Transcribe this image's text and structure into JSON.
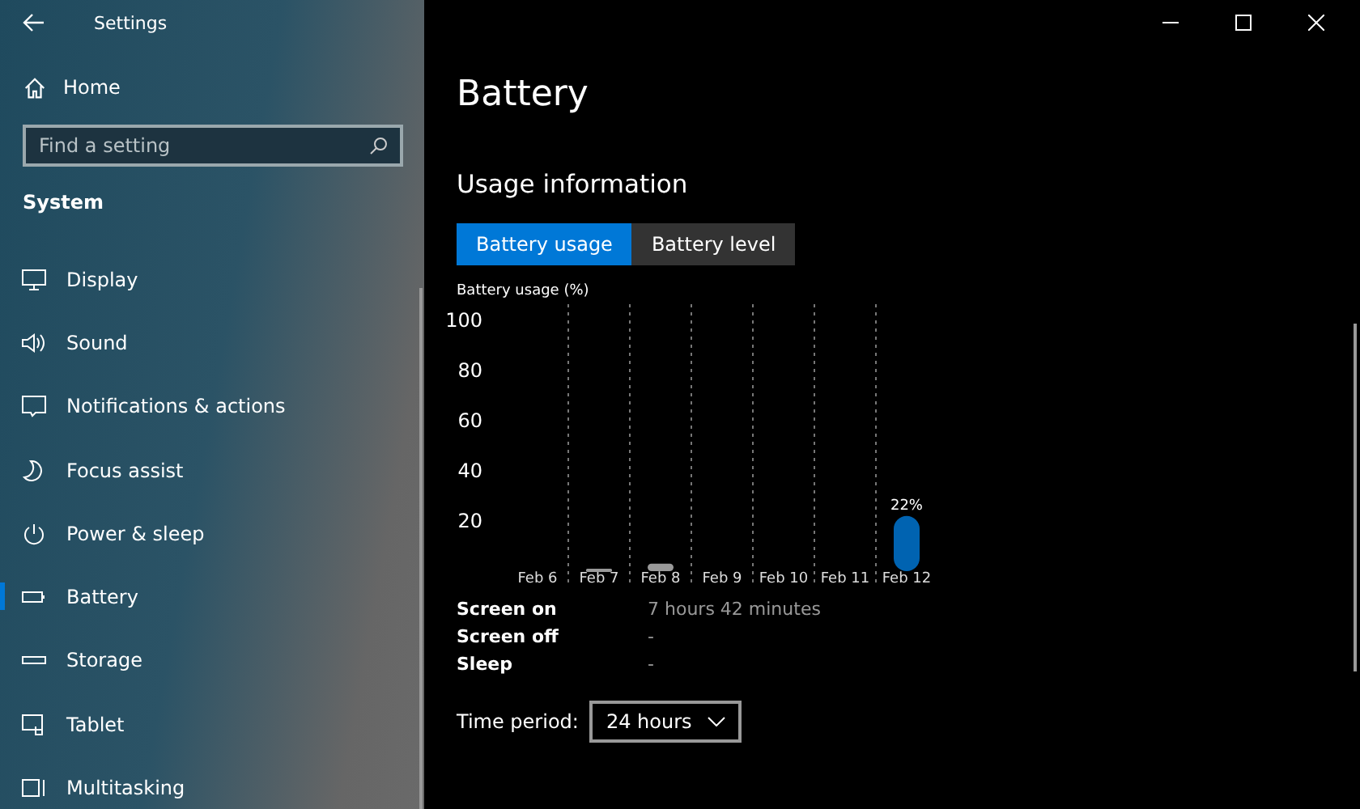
{
  "window": {
    "title": "Settings"
  },
  "sidebar": {
    "home": "Home",
    "search": {
      "placeholder": "Find a setting"
    },
    "section": "System",
    "items": [
      {
        "label": "Display",
        "selected": false
      },
      {
        "label": "Sound",
        "selected": false
      },
      {
        "label": "Notifications & actions",
        "selected": false
      },
      {
        "label": "Focus assist",
        "selected": false
      },
      {
        "label": "Power & sleep",
        "selected": false
      },
      {
        "label": "Battery",
        "selected": true
      },
      {
        "label": "Storage",
        "selected": false
      },
      {
        "label": "Tablet",
        "selected": false
      },
      {
        "label": "Multitasking",
        "selected": false
      }
    ]
  },
  "page": {
    "title": "Battery",
    "section": "Usage information",
    "tabs": [
      {
        "label": "Battery usage",
        "selected": true
      },
      {
        "label": "Battery level",
        "selected": false
      }
    ],
    "chart_data": {
      "type": "bar",
      "ylabel": "Battery usage (%)",
      "categories": [
        "Feb 6",
        "Feb 7",
        "Feb 8",
        "Feb 9",
        "Feb 10",
        "Feb 11",
        "Feb 12"
      ],
      "series": [
        {
          "color": "#0063b1",
          "values": [
            null,
            null,
            null,
            null,
            null,
            null,
            22
          ]
        },
        {
          "color": "#999999",
          "values": [
            null,
            1,
            3,
            null,
            null,
            null,
            null
          ]
        }
      ],
      "ylim": [
        0,
        100
      ],
      "yticks": [
        20,
        40,
        60,
        80,
        100
      ],
      "value_labels": [
        null,
        null,
        null,
        null,
        null,
        null,
        "22%"
      ]
    },
    "stats": [
      {
        "label": "Screen on",
        "value": "7 hours 42 minutes"
      },
      {
        "label": "Screen off",
        "value": "-"
      },
      {
        "label": "Sleep",
        "value": "-"
      }
    ],
    "time_period": {
      "label": "Time period:",
      "value": "24 hours"
    }
  }
}
